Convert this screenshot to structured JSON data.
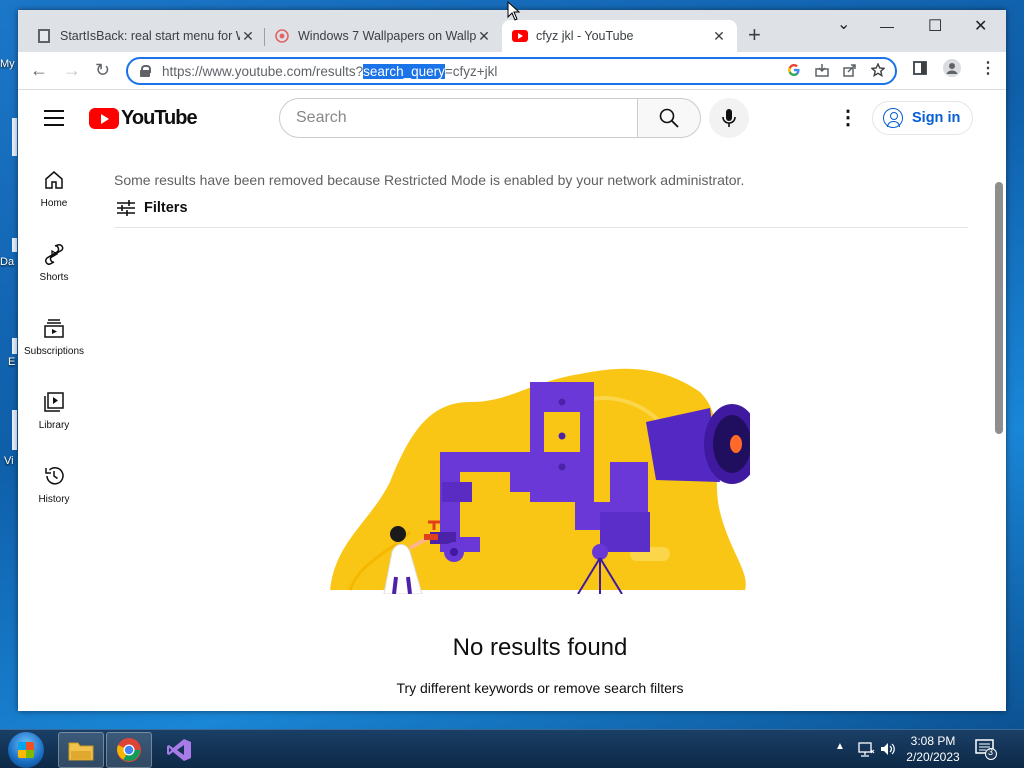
{
  "desktop": {
    "icons": [
      {
        "label": "My",
        "icon": "computer-icon"
      },
      {
        "label": "Da",
        "icon": "folder-icon"
      },
      {
        "label": "E",
        "icon": "browser-icon"
      },
      {
        "label": "Vi",
        "icon": "app-icon"
      }
    ]
  },
  "browser": {
    "tabs": [
      {
        "title": "StartIsBack: real start menu for W",
        "icon": "page-icon",
        "close": "✕"
      },
      {
        "title": "Windows 7 Wallpapers on Wallp",
        "icon": "wallpaper-icon",
        "close": "✕"
      },
      {
        "title": "cfyz jkl - YouTube",
        "icon": "youtube-favicon",
        "close": "✕"
      }
    ],
    "new_tab": "+",
    "window_controls": {
      "collapse": "⌄",
      "minimize": "—",
      "maximize": "☐",
      "close": "✕"
    },
    "nav": {
      "back": "←",
      "forward": "→",
      "reload": "↻"
    },
    "address": {
      "base": "https://www.youtube.com/results?",
      "selected": "search_query",
      "rest": "=cfyz+jkl"
    }
  },
  "youtube": {
    "logo_text": "YouTube",
    "search_placeholder": "Search",
    "signin_label": "Sign in",
    "guide": [
      {
        "label": "Home",
        "icon": "home-icon"
      },
      {
        "label": "Shorts",
        "icon": "shorts-icon"
      },
      {
        "label": "Subscriptions",
        "icon": "subscriptions-icon"
      },
      {
        "label": "Library",
        "icon": "library-icon"
      },
      {
        "label": "History",
        "icon": "history-icon"
      }
    ],
    "restricted_notice": "Some results have been removed because Restricted Mode is enabled by your network administrator.",
    "filters_label": "Filters",
    "no_results_title": "No results found",
    "no_results_hint": "Try different keywords or remove search filters"
  },
  "taskbar": {
    "apps": [
      {
        "name": "file-explorer",
        "icon": "folder-icon"
      },
      {
        "name": "chrome",
        "icon": "chrome-icon"
      },
      {
        "name": "visual-studio",
        "icon": "visual-studio-icon"
      }
    ],
    "time": "3:08 PM",
    "date": "2/20/2023",
    "notification_count": "3"
  },
  "colors": {
    "accent": "#1a73e8",
    "youtube_red": "#ff0000",
    "illustration_yellow": "#f9c615",
    "illustration_purple": "#6633cc"
  }
}
